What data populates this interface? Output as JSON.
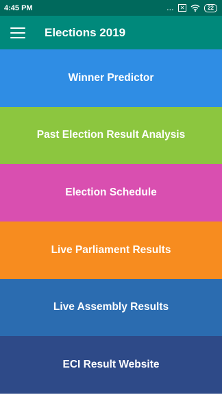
{
  "status_bar": {
    "time": "4:45 PM",
    "dots": "...",
    "sim_icon": "sim-x-icon",
    "wifi_icon": "wifi-icon",
    "battery": "22"
  },
  "app_bar": {
    "menu_icon": "hamburger-menu-icon",
    "title": "Elections 2019",
    "color": "#00897b"
  },
  "tiles": [
    {
      "label": "Winner Predictor",
      "color": "#2f8de4"
    },
    {
      "label": "Past Election Result Analysis",
      "color": "#8cc63f"
    },
    {
      "label": "Election Schedule",
      "color": "#d94fb0"
    },
    {
      "label": "Live Parliament Results",
      "color": "#f78c1f"
    },
    {
      "label": "Live Assembly Results",
      "color": "#2b6cb0"
    },
    {
      "label": "ECI Result Website",
      "color": "#2e4a88"
    }
  ]
}
